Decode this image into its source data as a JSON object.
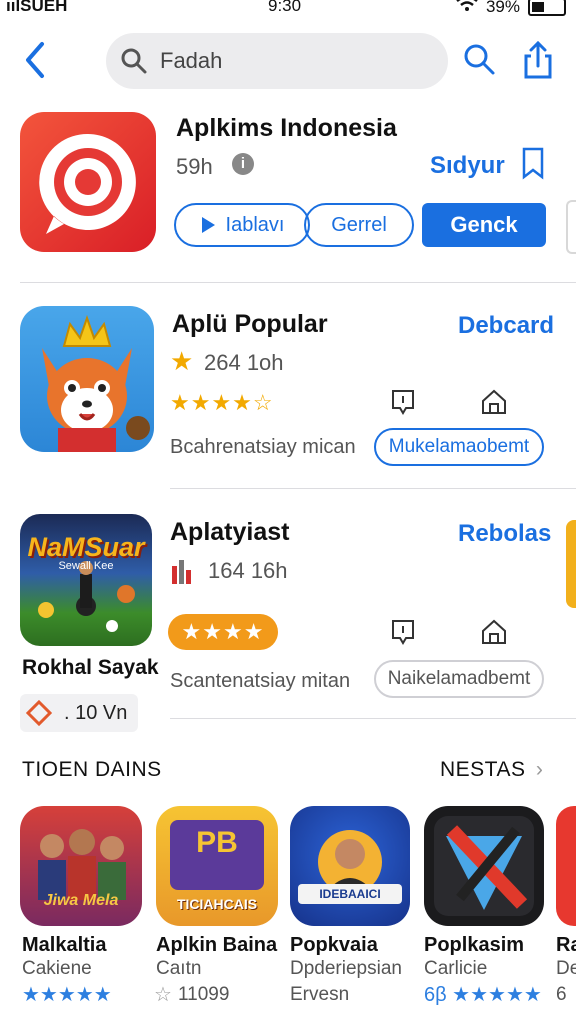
{
  "status": {
    "carrier": "ıılSUEH",
    "time": "9:30",
    "battery": "39%"
  },
  "nav": {
    "search_text": "Fadah"
  },
  "featured": {
    "title": "Aplkims Indonesia",
    "meta": "59h",
    "action_link": "Sıdyur",
    "btn_play": "Iablavı",
    "btn_general": "Gerrel",
    "btn_get": "Genck"
  },
  "app1": {
    "title": "Aplü Popular",
    "meta": "264 1oh",
    "link": "Debcard",
    "description": "Bcahrenatsiay mican",
    "pill": "Mukelamaobemt",
    "stars": "★★★★☆"
  },
  "app2": {
    "icon_title": "NaMSuar",
    "icon_sub": "Sewall Kee",
    "title": "Aplatyiast",
    "meta": "164 16h",
    "link": "Rebolas",
    "description": "Scantenatsiay mitan",
    "pill": "Naikelamadbemt",
    "stars": "★★★★",
    "side_name": "Rokhal Sayak",
    "side_value": ". 10 Vn"
  },
  "section": {
    "left": "TIOEN DAINS",
    "right": "NESTAS"
  },
  "grid": [
    {
      "name": "Malkaltia",
      "sub": "Cakiene",
      "rating": "★★★★★"
    },
    {
      "name": "Aplkin Baina",
      "sub": "Caıtn",
      "rating": "11099"
    },
    {
      "name": "Popkvaia",
      "sub": "Dpderiepsian",
      "rating": "Ervesn"
    },
    {
      "name": "Poplkasim",
      "sub": "Carlicie",
      "rating": "6β ★★★★★"
    },
    {
      "name": "Ra",
      "sub": "De",
      "rating": "6"
    }
  ],
  "grid_icon_texts": {
    "g1": "Jiwa Mela",
    "g2_top": "PB",
    "g2_bottom": "TICIAHCAIS",
    "g3": "IDEBAAICI"
  },
  "colors": {
    "accent": "#1a6fe0",
    "star": "#f2a900",
    "featured_red": "#e53935"
  }
}
